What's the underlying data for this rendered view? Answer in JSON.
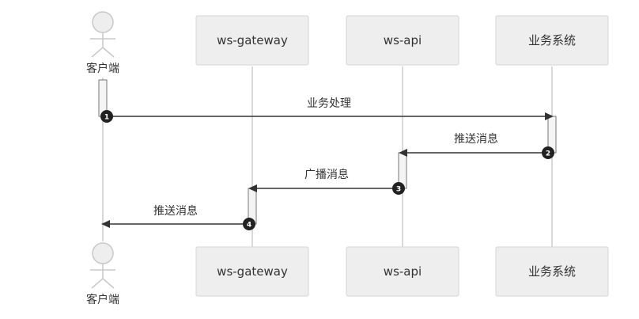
{
  "participants": [
    {
      "id": "client",
      "label": "客户端",
      "kind": "actor"
    },
    {
      "id": "gateway",
      "label": "ws-gateway",
      "kind": "box"
    },
    {
      "id": "api",
      "label": "ws-api",
      "kind": "box"
    },
    {
      "id": "biz",
      "label": "业务系统",
      "kind": "box"
    }
  ],
  "messages": [
    {
      "step": "1",
      "from": "client",
      "to": "biz",
      "label": "业务处理"
    },
    {
      "step": "2",
      "from": "biz",
      "to": "api",
      "label": "推送消息"
    },
    {
      "step": "3",
      "from": "api",
      "to": "gateway",
      "label": "广播消息"
    },
    {
      "step": "4",
      "from": "gateway",
      "to": "client",
      "label": "推送消息"
    }
  ],
  "colors": {
    "box_fill": "#eeeeee",
    "lifeline": "#d9d9d9",
    "arrow": "#333333",
    "badge": "#222222"
  }
}
